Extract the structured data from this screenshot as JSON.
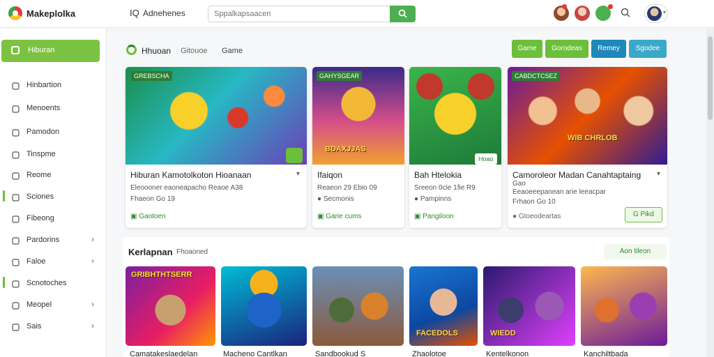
{
  "app": {
    "brand": "Makeplolka"
  },
  "topbar": {
    "nav_icon": "IQ",
    "nav_title": "Adnehenes",
    "search_placeholder": "Sppalkapsaacen"
  },
  "sidebar": {
    "active": {
      "label": "Hiburan",
      "icon": "home-icon"
    },
    "items": [
      {
        "label": "Hinbartion",
        "icon": "home-icon",
        "chevron": false,
        "marked": false
      },
      {
        "label": "Menoents",
        "icon": "bookmark-icon",
        "chevron": false,
        "marked": false
      },
      {
        "label": "Pamodon",
        "icon": "user-icon",
        "chevron": false,
        "marked": false
      },
      {
        "label": "Tinspme",
        "icon": "clock-icon",
        "chevron": false,
        "marked": false
      },
      {
        "label": "Reome",
        "icon": "search-icon",
        "chevron": false,
        "marked": false
      },
      {
        "label": "Sciones",
        "icon": "target-icon",
        "chevron": false,
        "marked": true
      },
      {
        "label": "Fibeong",
        "icon": "list-icon",
        "chevron": false,
        "marked": false
      },
      {
        "label": "Pardorins",
        "icon": "tag-icon",
        "chevron": true,
        "marked": false
      },
      {
        "label": "Faloe",
        "icon": "flag-icon",
        "chevron": true,
        "marked": false
      },
      {
        "label": "Scnotoches",
        "icon": "gear-icon",
        "chevron": false,
        "marked": true
      },
      {
        "label": "Meopel",
        "icon": "image-icon",
        "chevron": true,
        "marked": false
      },
      {
        "label": "Sais",
        "icon": "grid-icon",
        "chevron": true,
        "marked": false
      }
    ]
  },
  "section1": {
    "title": "Hhuoan",
    "sub1": "Gitouoe",
    "sub2": "Game",
    "filters": [
      "Game",
      "Gorodeas",
      "Remey",
      "Sgodee"
    ]
  },
  "cards": [
    {
      "title": "Hiburan Kamotolkoton Hioanaan",
      "meta1": "Eleoooner eaoneapacho  Reaoe A38",
      "meta2": "Fhaeon Go 19",
      "action": "Gaotoen",
      "badge": "GREBSCHA",
      "art_label": ""
    },
    {
      "title": "Ifaiqon",
      "meta1": "Reaeon 29 Ebio 09",
      "meta2": "Secmonis",
      "action": "Garie cums",
      "badge": "GAHYSGEAR",
      "art_label": "BDAXJJAS"
    },
    {
      "title": "Bah Htelokia",
      "meta1": "Sreeon 0cie 1fie R9",
      "meta2": "Pampinns",
      "action": "Pangiloon",
      "badge": "",
      "tag": "Hoao",
      "art_label": ""
    },
    {
      "title": "Camoroleor Madan Canahtaptaing",
      "meta1": "Gao",
      "meta2": "Eeaoeeepanean arie leeacpar",
      "meta3": "Frhaon Go 10",
      "action": "Gtoeodeartas",
      "button": "G Pikd",
      "badge": "CABDCTCSEZ",
      "art_label": "WIB CHRLOB"
    }
  ],
  "section2": {
    "title": "Kerlapnan",
    "sub": "Fhoaoned",
    "more": "Aon tileon",
    "tiles": [
      {
        "caption": "Camatakeslaedelan",
        "art_label": "GRIBHTHTSERR"
      },
      {
        "caption": "Macheno Cantlkan",
        "art_label": ""
      },
      {
        "caption": "Sandbookud S",
        "art_label": ""
      },
      {
        "caption": "Zhaolotoe",
        "art_label": "FACEDOLS"
      },
      {
        "caption": "Kentelkonon",
        "art_label": "WIEDD"
      },
      {
        "caption": "Kanchiltbada",
        "art_label": ""
      }
    ]
  },
  "colors": {
    "accent_green": "#6bbf3a",
    "active_green": "#7cc242",
    "blue": "#1e88b8",
    "teal": "#3aa9c9"
  }
}
